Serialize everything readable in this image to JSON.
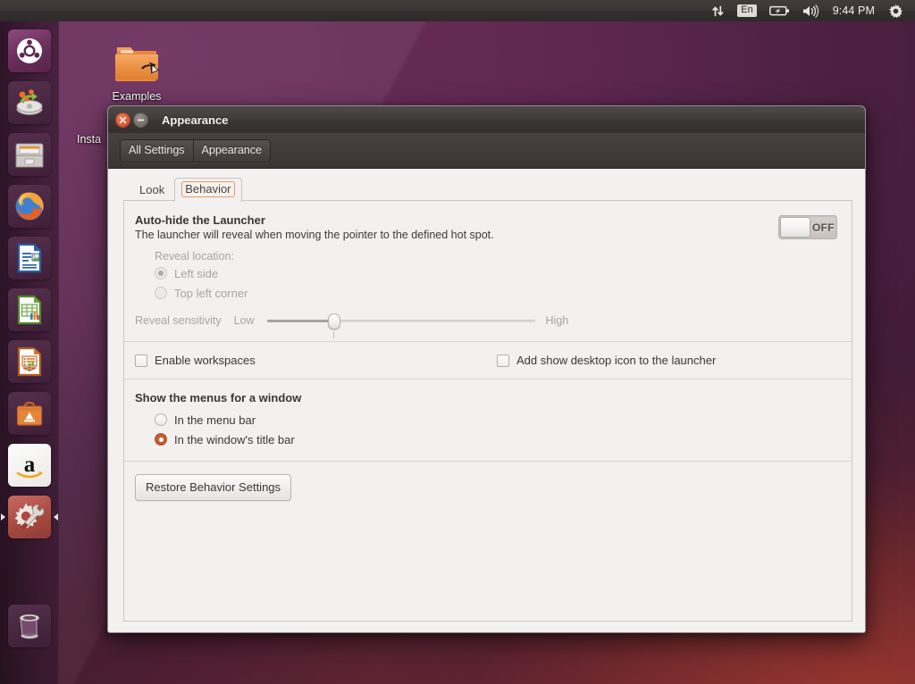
{
  "panel": {
    "indicators": [
      {
        "name": "network-transfer-icon",
        "label": ""
      },
      {
        "name": "keyboard-layout-indicator",
        "label": "En"
      },
      {
        "name": "battery-icon",
        "label": ""
      },
      {
        "name": "volume-icon",
        "label": ""
      }
    ],
    "clock": "9:44 PM",
    "session_menu": "gear-icon"
  },
  "launcher": {
    "items": [
      {
        "name": "ubuntu-dash",
        "label": "Dash home"
      },
      {
        "name": "install-ubuntu",
        "label": "Install Ubuntu"
      },
      {
        "name": "files-nautilus",
        "label": "Files"
      },
      {
        "name": "firefox",
        "label": "Firefox Web Browser"
      },
      {
        "name": "libreoffice-writer",
        "label": "LibreOffice Writer"
      },
      {
        "name": "libreoffice-calc",
        "label": "LibreOffice Calc"
      },
      {
        "name": "libreoffice-impress",
        "label": "LibreOffice Impress"
      },
      {
        "name": "ubuntu-software-center",
        "label": "Ubuntu Software Center"
      },
      {
        "name": "amazon",
        "label": "Amazon"
      },
      {
        "name": "system-settings",
        "label": "System Settings",
        "running": true
      },
      {
        "name": "trash",
        "label": "Trash"
      }
    ]
  },
  "desktop": {
    "icons": [
      {
        "name": "examples-folder",
        "label": "Examples"
      },
      {
        "name": "install-ubuntu-desktop",
        "label": "Insta"
      }
    ]
  },
  "window": {
    "title": "Appearance",
    "close_button": "×",
    "minimize_button": "−",
    "toolbar": {
      "all_settings_label": "All Settings",
      "appearance_label": "Appearance"
    },
    "tabs": [
      {
        "label": "Look",
        "active": false
      },
      {
        "label": "Behavior",
        "active": true
      }
    ],
    "autohide": {
      "title": "Auto-hide the Launcher",
      "description": "The launcher will reveal when moving the pointer to the defined hot spot.",
      "toggle_state": "OFF",
      "reveal_location_label": "Reveal location:",
      "reveal_options": [
        {
          "label": "Left side",
          "selected": true,
          "disabled": true
        },
        {
          "label": "Top left corner",
          "selected": false,
          "disabled": true
        }
      ],
      "sensitivity_label": "Reveal sensitivity",
      "sensitivity_low": "Low",
      "sensitivity_high": "High",
      "sensitivity_value": 25
    },
    "checkboxes": [
      {
        "label": "Enable workspaces",
        "checked": false
      },
      {
        "label": "Add show desktop icon to the launcher",
        "checked": false
      }
    ],
    "menus_section": {
      "title": "Show the menus for a window",
      "options": [
        {
          "label": "In the menu bar",
          "selected": false
        },
        {
          "label": "In the window's title bar",
          "selected": true
        }
      ]
    },
    "restore_button_label": "Restore Behavior Settings"
  },
  "colors": {
    "desktop_purple": "#5e2750",
    "desktop_red": "#8e3631",
    "accent_orange": "#c05a2e",
    "panel_dark": "#3b3635",
    "window_bg": "#f2f1f0"
  }
}
